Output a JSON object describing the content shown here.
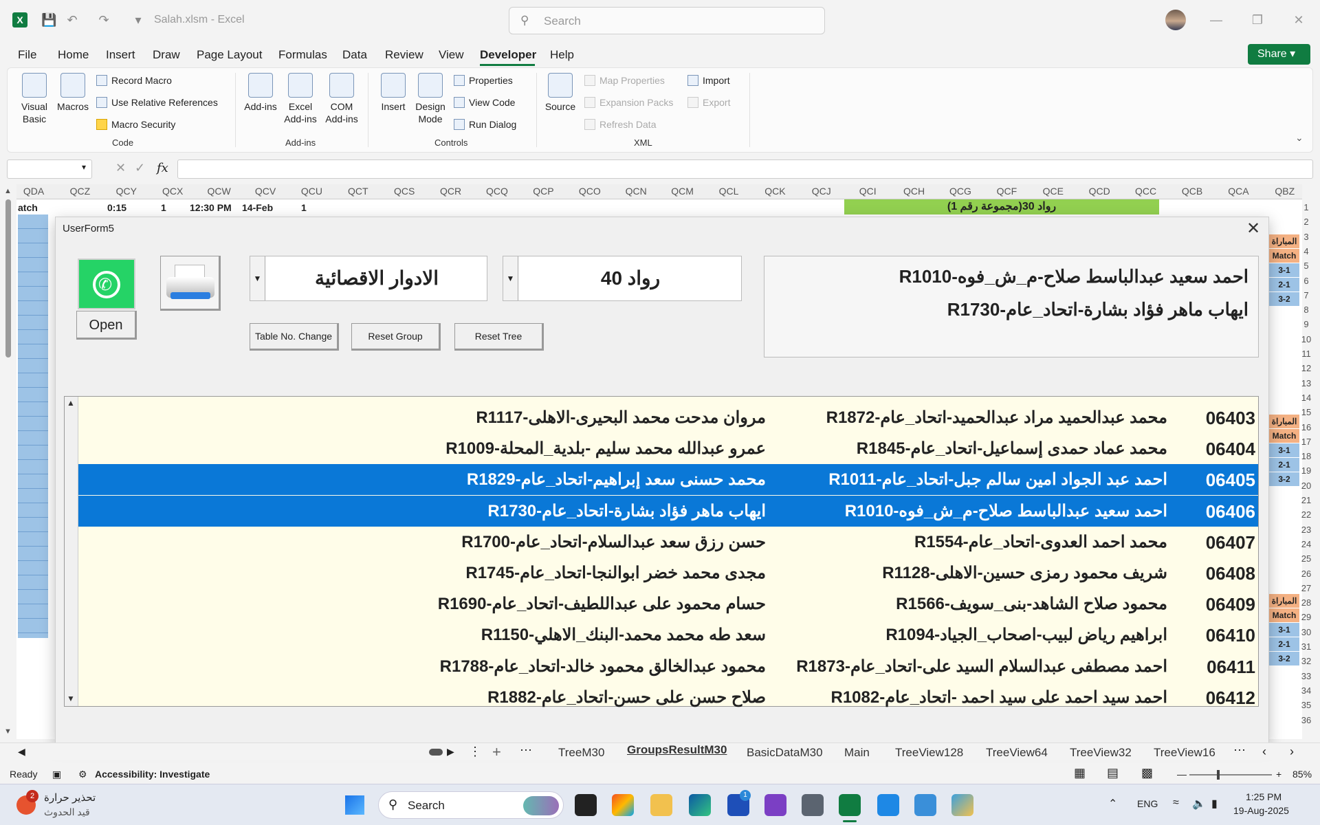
{
  "titlebar": {
    "app_logo": "X",
    "doc_title": "Salah.xlsm  -  Excel",
    "search_placeholder": "Search"
  },
  "menu": {
    "items": [
      "File",
      "Home",
      "Insert",
      "Draw",
      "Page Layout",
      "Formulas",
      "Data",
      "Review",
      "View",
      "Developer",
      "Help"
    ],
    "active": "Developer",
    "share": "Share"
  },
  "ribbon": {
    "code": {
      "visual_basic": "Visual Basic",
      "macros": "Macros",
      "record_macro": "Record Macro",
      "relative_refs": "Use Relative References",
      "macro_security": "Macro Security",
      "label": "Code"
    },
    "addins": {
      "addins": "Add-ins",
      "excel_addins": "Excel Add-ins",
      "com_addins": "COM Add-ins",
      "label": "Add-ins"
    },
    "controls": {
      "insert": "Insert",
      "design_mode": "Design Mode",
      "properties": "Properties",
      "view_code": "View Code",
      "run_dialog": "Run Dialog",
      "label": "Controls"
    },
    "xml": {
      "source": "Source",
      "map_properties": "Map Properties",
      "expansion_packs": "Expansion Packs",
      "refresh_data": "Refresh Data",
      "import": "Import",
      "export": "Export",
      "label": "XML"
    }
  },
  "formula_bar": {
    "fx": "fx"
  },
  "sheet": {
    "columns": [
      "QDA",
      "QCZ",
      "QCY",
      "QCX",
      "QCW",
      "QCV",
      "QCU",
      "QCT",
      "QCS",
      "QCR",
      "QCQ",
      "QCP",
      "QCO",
      "QCN",
      "QCM",
      "QCL",
      "QCK",
      "QCJ",
      "QCI",
      "QCH",
      "QCG",
      "QCF",
      "QCE",
      "QCD",
      "QCC",
      "QCB",
      "QCA",
      "QBZ"
    ],
    "row1": {
      "a": "atch",
      "b": "0:15",
      "c": "1",
      "d": "12:30 PM",
      "e": "14-Feb",
      "f": "1"
    },
    "banner": "رواد 30(مجموعة رقم 1)",
    "rows": [
      "1",
      "2",
      "3",
      "4",
      "5",
      "6",
      "7",
      "8",
      "9",
      "10",
      "11",
      "12",
      "13",
      "14",
      "15",
      "16",
      "17",
      "18",
      "19",
      "20",
      "21",
      "22",
      "23",
      "24",
      "25",
      "26",
      "27",
      "28",
      "29",
      "30",
      "31",
      "32",
      "33",
      "34",
      "35",
      "36"
    ],
    "match_blocks": [
      [
        "المباراة",
        "Match",
        "3-1",
        "2-1",
        "3-2"
      ],
      [
        "المباراة",
        "Match",
        "3-1",
        "2-1",
        "3-2"
      ],
      [
        "المباراة",
        "Match",
        "3-1",
        "2-1",
        "3-2"
      ]
    ]
  },
  "userform": {
    "title": "UserForm5",
    "open_label": "Open",
    "combo_round": "الادوار الاقصائية",
    "combo_group": "رواد 40",
    "btn_table_change": "Table No. Change",
    "btn_reset_group": "Reset Group",
    "btn_reset_tree": "Reset Tree",
    "info_line1": "احمد سعيد عبدالباسط صلاح-م_ش_فوه-R1010",
    "info_line2": "ايهاب ماهر فؤاد بشارة-اتحاد_عام-R1730",
    "list": [
      {
        "no": "06403",
        "p1": "محمد عبدالحميد مراد عبدالحميد-اتحاد_عام-R1872",
        "p2": "مروان مدحت محمد البحيرى-الاهلى-R1117",
        "selected": false
      },
      {
        "no": "06404",
        "p1": "محمد عماد حمدى إسماعيل-اتحاد_عام-R1845",
        "p2": "عمرو عبدالله محمد سليم -بلدية_المحلة-R1009",
        "selected": false
      },
      {
        "no": "06405",
        "p1": "احمد عبد الجواد امين سالم جبل-اتحاد_عام-R1011",
        "p2": "محمد حسنى سعد إبراهيم-اتحاد_عام-R1829",
        "selected": true
      },
      {
        "no": "06406",
        "p1": "احمد سعيد عبدالباسط صلاح-م_ش_فوه-R1010",
        "p2": "ايهاب ماهر فؤاد بشارة-اتحاد_عام-R1730",
        "selected": true
      },
      {
        "no": "06407",
        "p1": "محمد احمد العدوى-اتحاد_عام-R1554",
        "p2": "حسن رزق سعد عبدالسلام-اتحاد_عام-R1700",
        "selected": false
      },
      {
        "no": "06408",
        "p1": "شريف محمود رمزى حسين-الاهلى-R1128",
        "p2": "مجدى محمد خضر ابوالنجا-اتحاد_عام-R1745",
        "selected": false
      },
      {
        "no": "06409",
        "p1": "محمود صلاح الشاهد-بنى_سويف-R1566",
        "p2": "حسام محمود على عبداللطيف-اتحاد_عام-R1690",
        "selected": false
      },
      {
        "no": "06410",
        "p1": "ابراهيم رياض لبيب-اصحاب_الجياد-R1094",
        "p2": "سعد طه محمد محمد-البنك_الاهلي-R1150",
        "selected": false
      },
      {
        "no": "06411",
        "p1": "احمد مصطفى عبدالسلام السيد على-اتحاد_عام-R1873",
        "p2": "محمود عبدالخالق محمود خالد-اتحاد_عام-R1788",
        "selected": false
      },
      {
        "no": "06412",
        "p1": "احمد سيد احمد على سيد احمد -اتحاد_عام-R1082",
        "p2": "صلاح حسن على حسن-اتحاد_عام-R1882",
        "selected": false
      }
    ]
  },
  "tabs": [
    "TreeM30",
    "GroupsResultM30",
    "BasicDataM30",
    "Main",
    "TreeView128",
    "TreeView64",
    "TreeView32",
    "TreeView16"
  ],
  "active_tab": "GroupsResultM30",
  "status": {
    "ready": "Ready",
    "accessibility": "Accessibility: Investigate",
    "zoom": "85%"
  },
  "taskbar": {
    "weather_title": "تحذير حرارة",
    "weather_sub": "قيد الحدوث",
    "weather_badge": "2",
    "search": "Search",
    "badge_store": "1",
    "lang": "ENG",
    "time": "1:25 PM",
    "date": "19-Aug-2025"
  }
}
